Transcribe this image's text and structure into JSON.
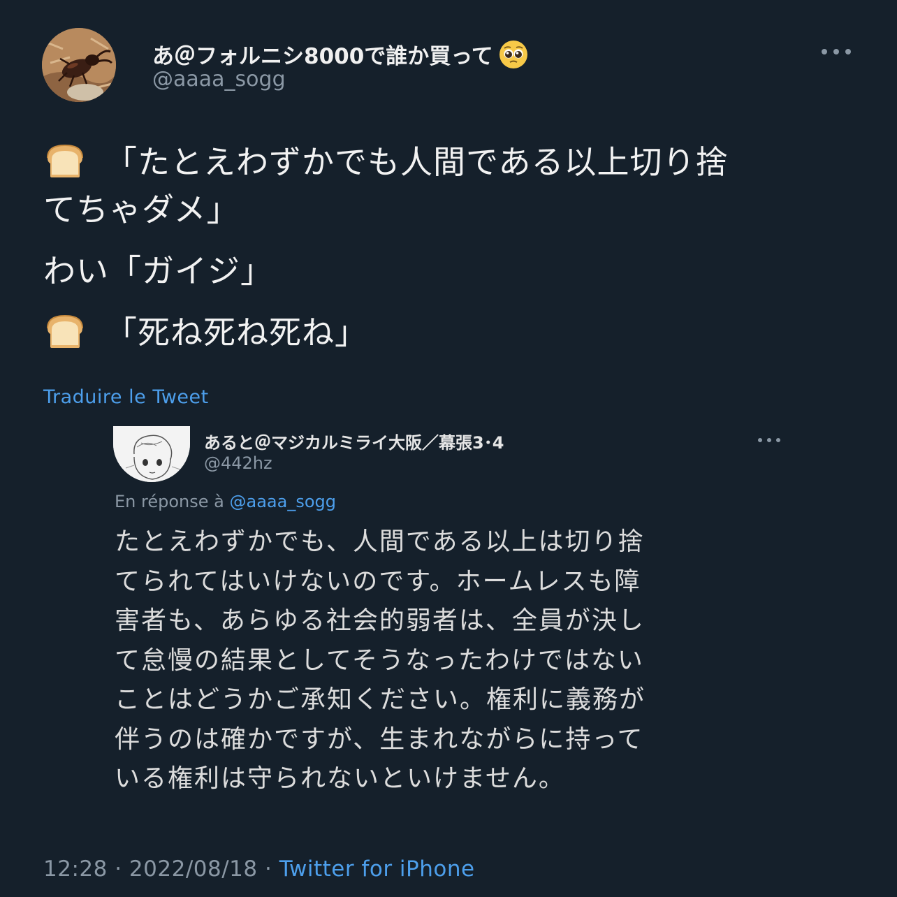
{
  "author": {
    "display_name": "あ＠フォルニシ8000で誰か買って",
    "name_emoji": "pleading-face-icon",
    "handle": "@aaaa_sogg",
    "avatar": "stag-beetle-photo"
  },
  "tweet": {
    "lines": [
      {
        "emoji": "bread-icon",
        "text": "「たとえわずかでも人間である以上切り捨"
      },
      {
        "emoji": null,
        "text": "てちゃダメ」"
      },
      {
        "emoji": null,
        "text": "わい「ガイジ」"
      },
      {
        "emoji": "bread-icon",
        "text": "「死ね死ね死ね」"
      }
    ],
    "translate_label": "Traduire le Tweet"
  },
  "quoted": {
    "display_name": "あると＠マジカルミライ大阪／幕張3･4",
    "handle": "@442hz",
    "avatar": "manga-sketch-avatar",
    "reply_prefix": "En réponse à",
    "reply_mention": "@aaaa_sogg",
    "lines": [
      "たとえわずかでも、人間である以上は切り捨",
      "てられてはいけないのです。ホームレスも障",
      "害者も、あらゆる社会的弱者は、全員が決し",
      "て怠慢の結果としてそうなったわけではない",
      "ことはどうかご承知ください。権利に義務が",
      "伴うのは確かですが、生まれながらに持って",
      "いる権利は守られないといけません。"
    ]
  },
  "footer": {
    "time": "12:28",
    "separator": "·",
    "date": "2022/08/18",
    "source": "Twitter for iPhone"
  },
  "colors": {
    "background": "#15202b",
    "link": "#4d9fec",
    "secondary_text": "#8b98a5"
  }
}
